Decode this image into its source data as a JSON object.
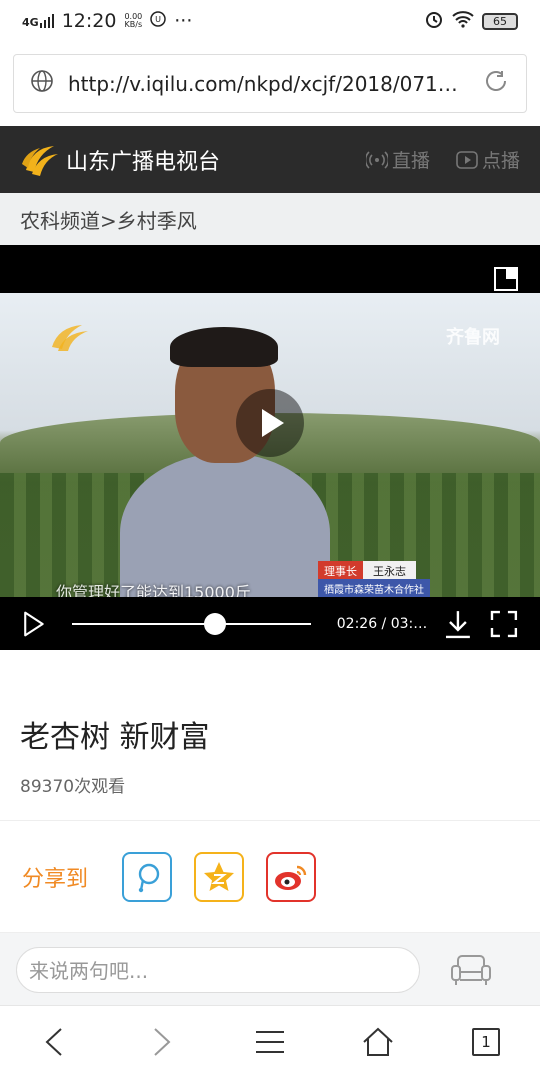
{
  "status": {
    "network": "4G",
    "time": "12:20",
    "speed_value": "0.00",
    "speed_unit": "KB/s",
    "dots": "···",
    "battery": "65"
  },
  "browser": {
    "url": "http://v.iqilu.com/nkpd/xcjf/2018/0713/…"
  },
  "site": {
    "name": "山东广播电视台",
    "nav": [
      "直播",
      "点播"
    ]
  },
  "breadcrumb": "农科频道>乡村季风",
  "video": {
    "watermark": "齐鲁网",
    "lower_third_role": "理事长",
    "lower_third_name": "王永志",
    "lower_third_org": "栖霞市森荣苗木合作社",
    "subtitle": "你管理好了能达到15000斤",
    "time_display": "02:26 / 03:…",
    "progress": 0.6
  },
  "article": {
    "title": "老杏树 新财富",
    "views": "89370次观看"
  },
  "share": {
    "label": "分享到",
    "targets": [
      "qq-share",
      "qzone-share",
      "weibo-share"
    ],
    "colors": {
      "qq": "#3aa0d8",
      "qzone": "#f5b21a",
      "weibo": "#e2332b"
    }
  },
  "comment": {
    "placeholder": "来说两句吧..."
  },
  "bottom_nav": {
    "tabs_count": "1"
  }
}
